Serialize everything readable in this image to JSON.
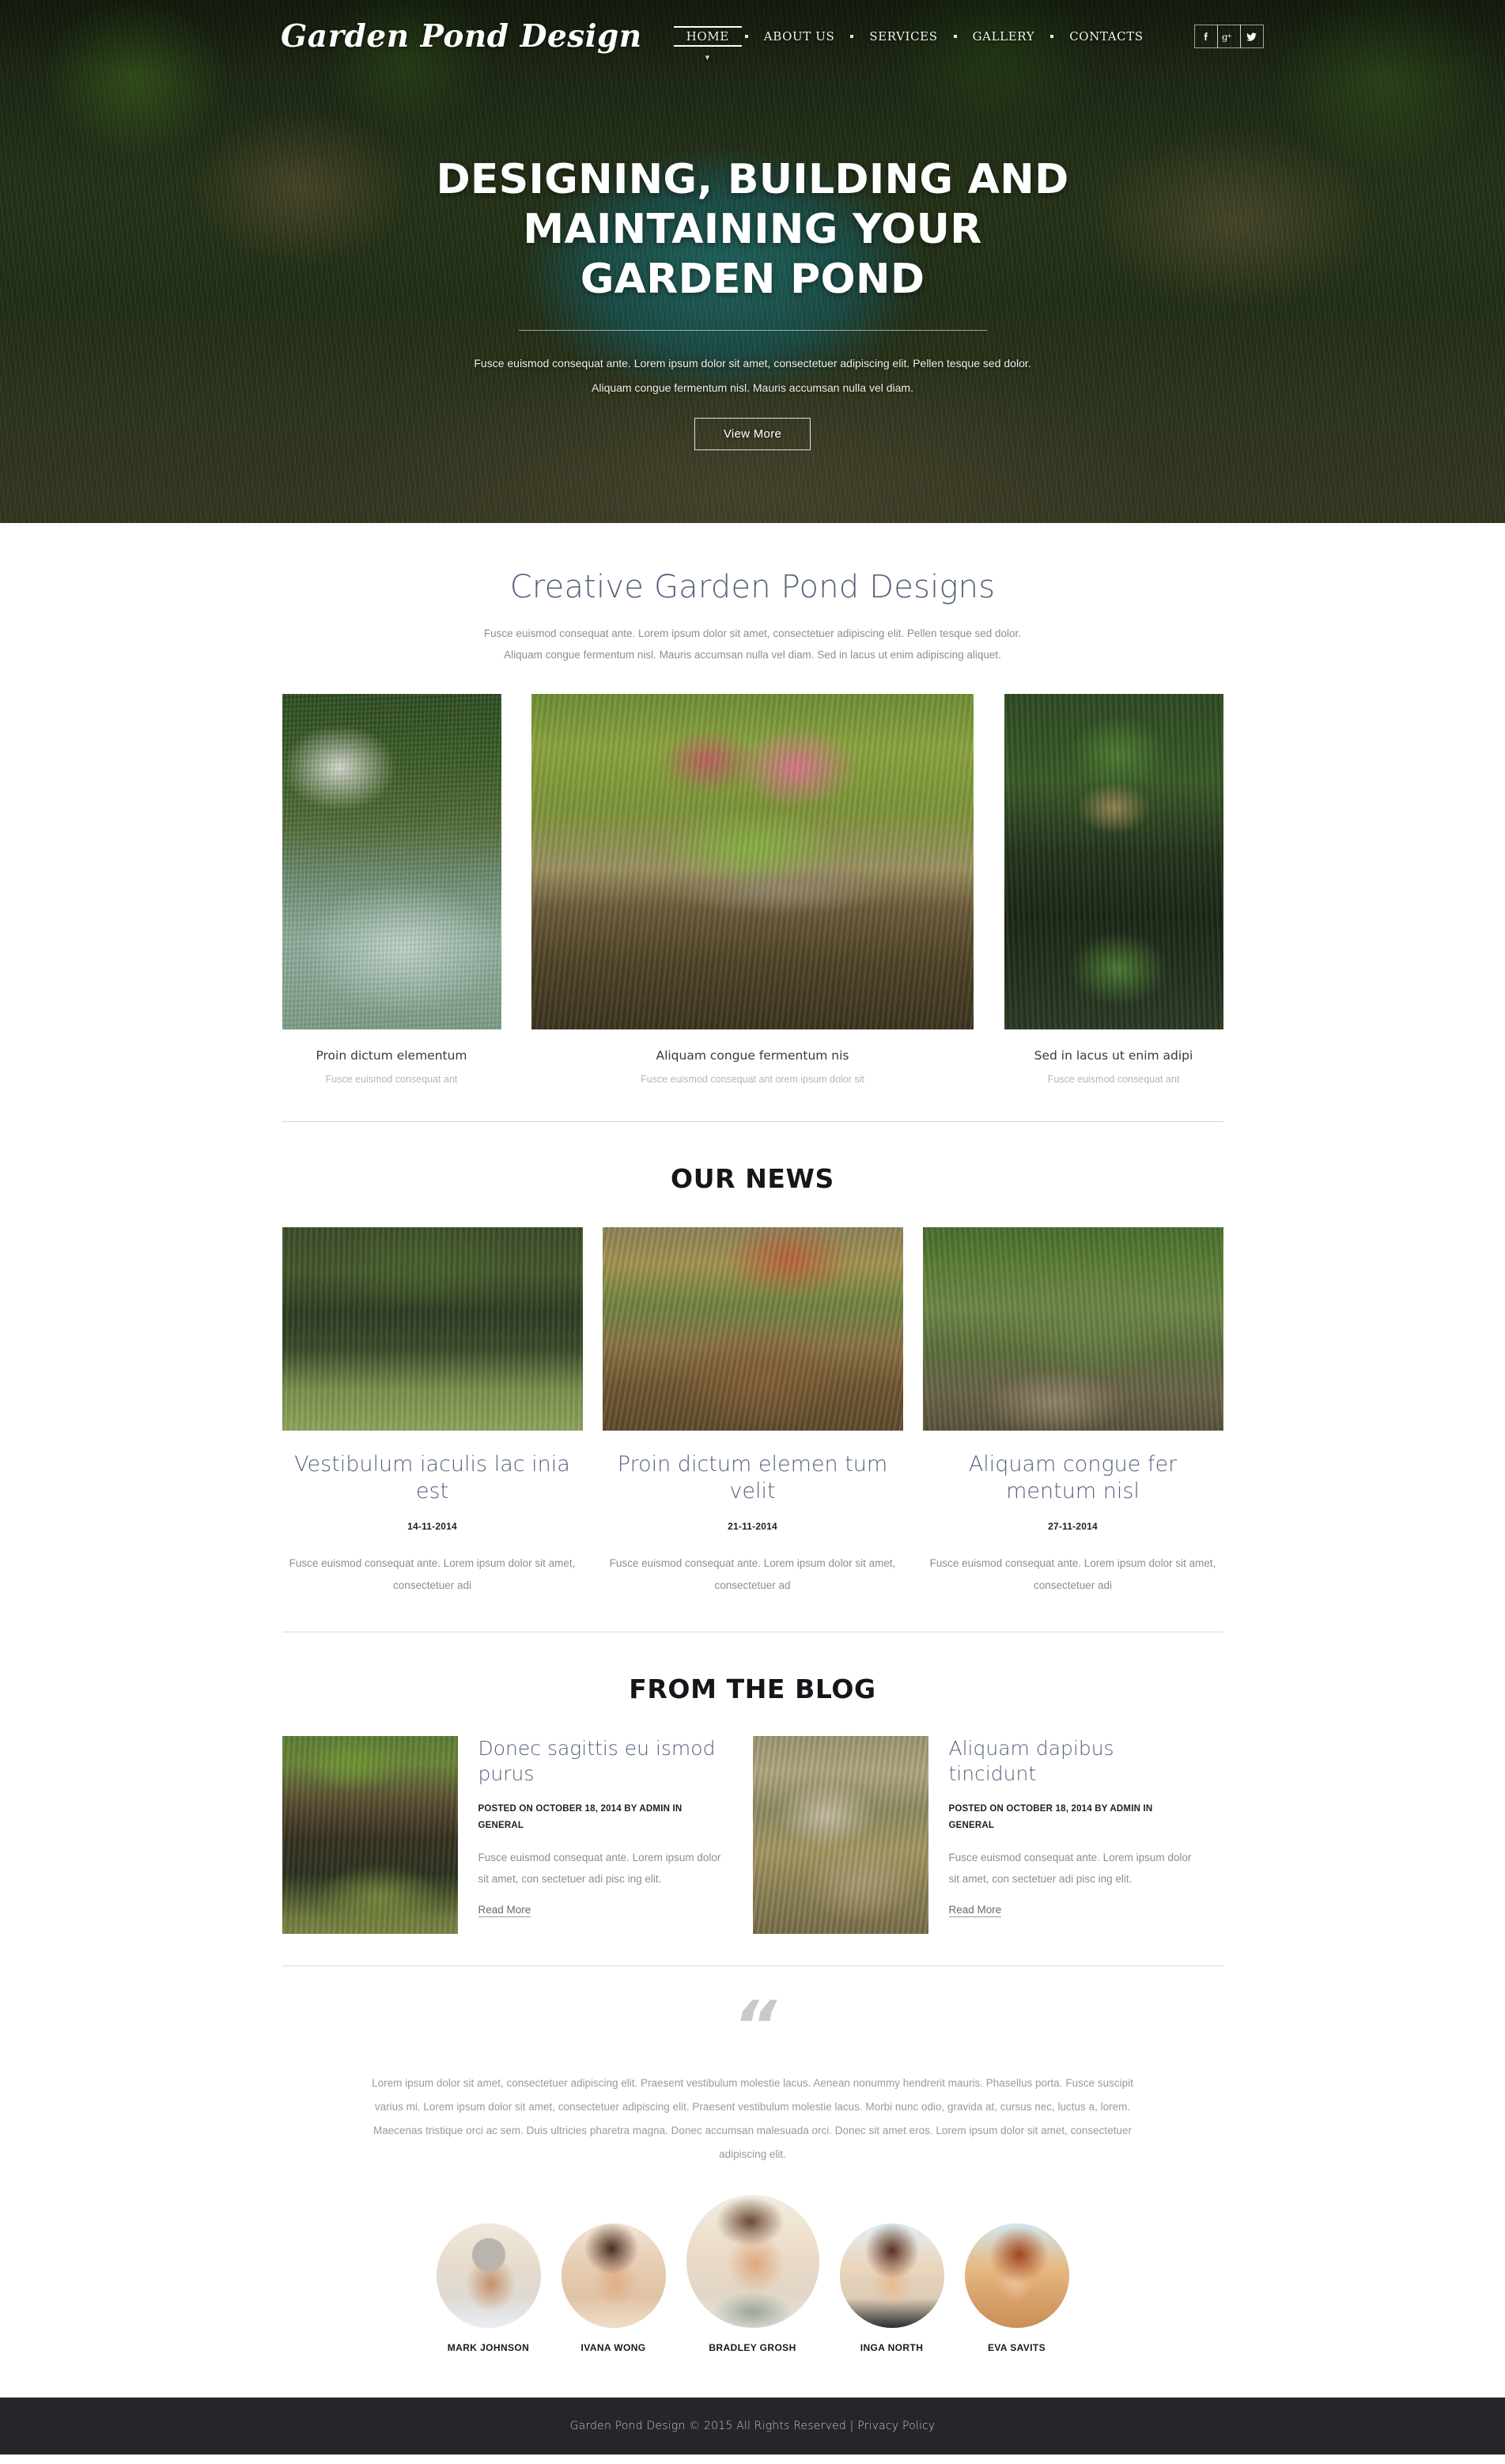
{
  "header": {
    "logo": "Garden Pond Design",
    "nav": [
      {
        "label": "HOME",
        "active": true
      },
      {
        "label": "ABOUT US",
        "active": false
      },
      {
        "label": "SERVICES",
        "active": false
      },
      {
        "label": "GALLERY",
        "active": false
      },
      {
        "label": "CONTACTS",
        "active": false
      }
    ],
    "socials": [
      {
        "name": "facebook-icon",
        "label": "f"
      },
      {
        "name": "google-plus-icon",
        "label": "g+"
      },
      {
        "name": "twitter-icon",
        "label": "t"
      }
    ]
  },
  "hero": {
    "heading_line1": "DESIGNING, BUILDING AND",
    "heading_line2": "MAINTAINING YOUR",
    "heading_line3": "GARDEN POND",
    "paragraph_line1": "Fusce euismod consequat ante. Lorem ipsum dolor sit amet, consectetuer adipiscing elit. Pellen tesque sed dolor.",
    "paragraph_line2": "Aliquam congue fermentum nisl. Mauris accumsan nulla vel diam.",
    "button": "View More"
  },
  "designs": {
    "title": "Creative Garden Pond Designs",
    "subtitle_line1": "Fusce euismod consequat ante. Lorem ipsum dolor sit amet, consectetuer adipiscing elit. Pellen tesque sed dolor.",
    "subtitle_line2": "Aliquam congue fermentum nisl. Mauris accumsan nulla vel diam. Sed in lacus ut enim adipiscing aliquet.",
    "items": [
      {
        "caption": "Proin dictum elementum",
        "desc": "Fusce euismod consequat ant"
      },
      {
        "caption": "Aliquam congue fermentum nis",
        "desc": "Fusce euismod consequat ant orem ipsum dolor sit"
      },
      {
        "caption": "Sed in lacus ut enim adipi",
        "desc": "Fusce euismod consequat ant"
      }
    ]
  },
  "news": {
    "title": "OUR NEWS",
    "items": [
      {
        "heading": "Vestibulum iaculis lac inia est",
        "date": "14-11-2014",
        "text": "Fusce euismod consequat ante. Lorem ipsum dolor sit amet, consectetuer adi"
      },
      {
        "heading": "Proin dictum elemen tum velit",
        "date": "21-11-2014",
        "text": "Fusce euismod consequat ante. Lorem ipsum dolor sit amet, consectetuer ad"
      },
      {
        "heading": "Aliquam congue fer mentum nisl",
        "date": "27-11-2014",
        "text": "Fusce euismod consequat ante. Lorem ipsum dolor sit amet, consectetuer adi"
      }
    ]
  },
  "blog": {
    "title": "FROM THE BLOG",
    "posts": [
      {
        "heading": "Donec sagittis eu ismod purus",
        "meta": "POSTED ON OCTOBER 18, 2014 BY ADMIN IN GENERAL",
        "text": "Fusce euismod consequat ante. Lorem ipsum dolor sit amet, con sectetuer adi pisc ing elit.",
        "more": "Read More"
      },
      {
        "heading": "Aliquam dapibus tincidunt",
        "meta": "POSTED ON OCTOBER 18, 2014 BY ADMIN IN GENERAL",
        "text": "Fusce euismod consequat ante. Lorem ipsum dolor sit amet, con sectetuer adi pisc ing elit.",
        "more": "Read More"
      }
    ]
  },
  "quote": {
    "mark": "“",
    "text": "Lorem ipsum dolor sit amet, consectetuer adipiscing elit. Praesent vestibulum molestie lacus. Aenean nonummy hendrerit mauris. Phasellus porta. Fusce suscipit varius mi. Lorem ipsum dolor sit amet, consectetuer adipiscing elit. Praesent vestibulum molestie lacus. Morbi nunc odio, gravida at, cursus nec, luctus a, lorem. Maecenas tristique orci ac sem. Duis ultricies pharetra magna. Donec accumsan malesuada orci. Donec sit amet eros. Lorem ipsum dolor sit amet, consectetuer adipiscing elit."
  },
  "team": {
    "members": [
      {
        "name": "MARK JOHNSON",
        "size": "sm"
      },
      {
        "name": "IVANA WONG",
        "size": "sm"
      },
      {
        "name": "BRADLEY GROSH",
        "size": "lg"
      },
      {
        "name": "INGA NORTH",
        "size": "sm"
      },
      {
        "name": "EVA SAVITS",
        "size": "sm"
      }
    ]
  },
  "footer": {
    "copyright": "Garden Pond Design © 2015 All Rights Reserved |",
    "privacy": "Privacy Policy"
  },
  "colors": {
    "accent_blue": "#55617d",
    "dark_text": "#14161a",
    "muted_text": "#8e8e8e",
    "footer_bg": "#25262a"
  }
}
